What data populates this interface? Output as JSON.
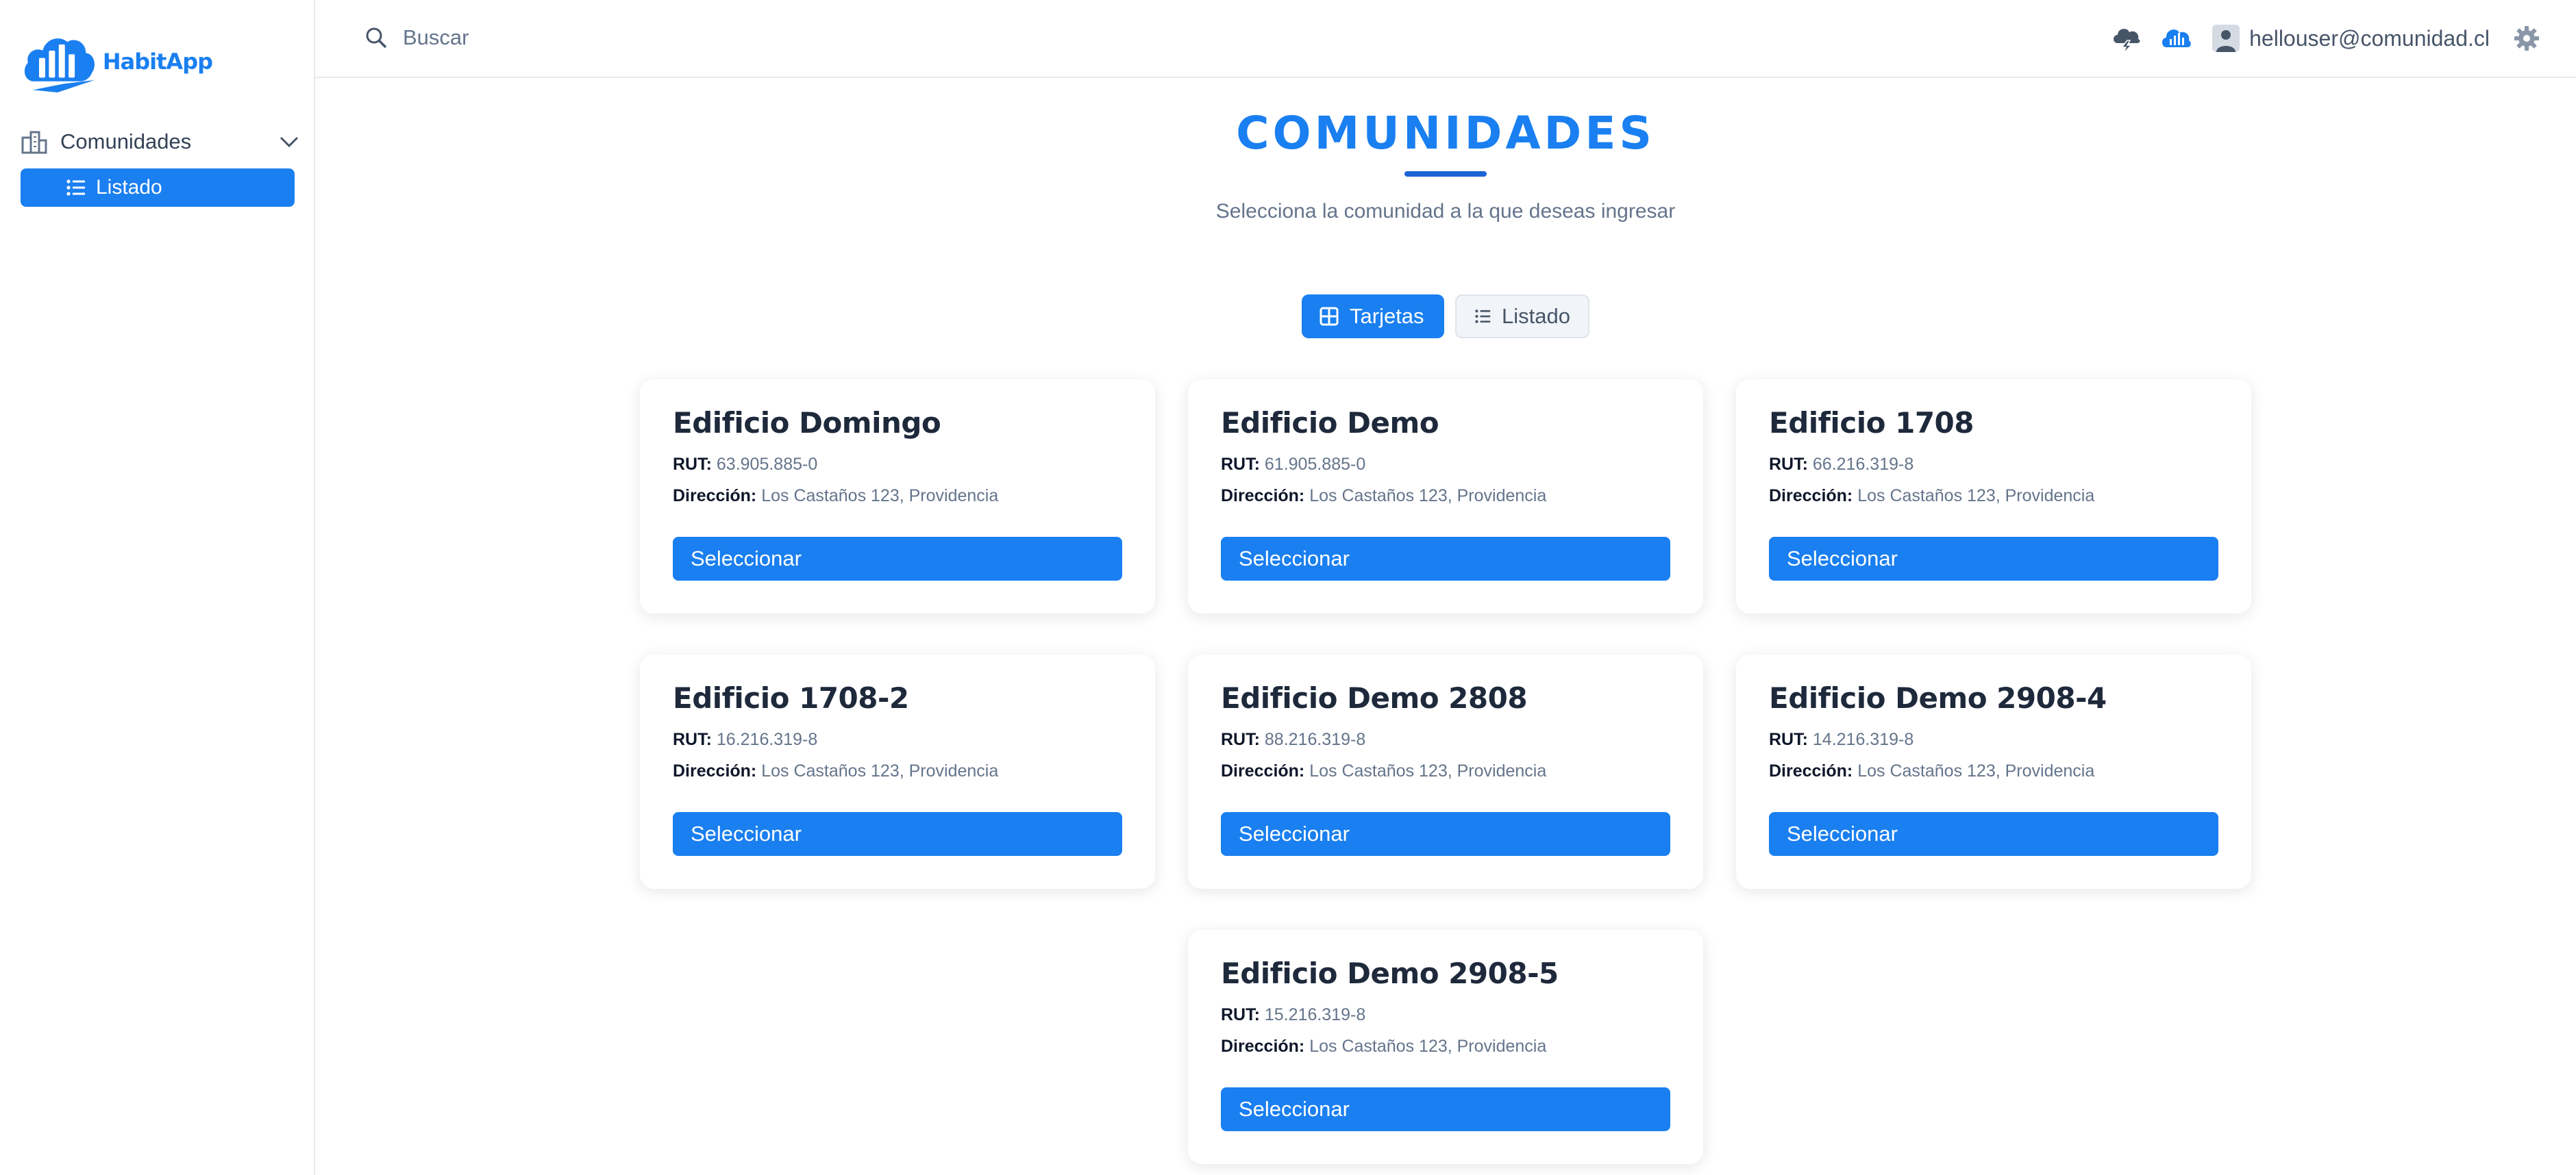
{
  "app": {
    "logo_text": "HabitApp"
  },
  "sidebar": {
    "group_label": "Comunidades",
    "items": [
      {
        "label": "Listado",
        "active": true
      }
    ]
  },
  "topbar": {
    "search_placeholder": "Buscar",
    "user_email": "hellouser@comunidad.cl",
    "icons": [
      "cloud-lightning-icon",
      "cloud-chart-icon",
      "user-avatar-icon",
      "gear-icon"
    ]
  },
  "main": {
    "title": "COMUNIDADES",
    "subtitle": "Selecciona la comunidad a la que deseas ingresar",
    "view_toggle": {
      "cards_label": "Tarjetas",
      "list_label": "Listado",
      "active": "cards"
    },
    "rut_label": "RUT:",
    "address_label": "Dirección:",
    "select_label": "Seleccionar",
    "communities": [
      {
        "name": "Edificio Domingo",
        "rut": "63.905.885-0",
        "address": "Los Castaños 123, Providencia"
      },
      {
        "name": "Edificio Demo",
        "rut": "61.905.885-0",
        "address": "Los Castaños 123, Providencia"
      },
      {
        "name": "Edificio 1708",
        "rut": "66.216.319-8",
        "address": "Los Castaños 123, Providencia"
      },
      {
        "name": "Edificio 1708-2",
        "rut": "16.216.319-8",
        "address": "Los Castaños 123, Providencia"
      },
      {
        "name": "Edificio Demo 2808",
        "rut": "88.216.319-8",
        "address": "Los Castaños 123, Providencia"
      },
      {
        "name": "Edificio Demo 2908-4",
        "rut": "14.216.319-8",
        "address": "Los Castaños 123, Providencia"
      },
      {
        "name": "Edificio Demo 2908-5",
        "rut": "15.216.319-8",
        "address": "Los Castaños 123, Providencia"
      }
    ]
  },
  "colors": {
    "accent": "#1a7ff0",
    "underline": "#1d63d6",
    "text": "#1e293b",
    "muted": "#64748b"
  }
}
